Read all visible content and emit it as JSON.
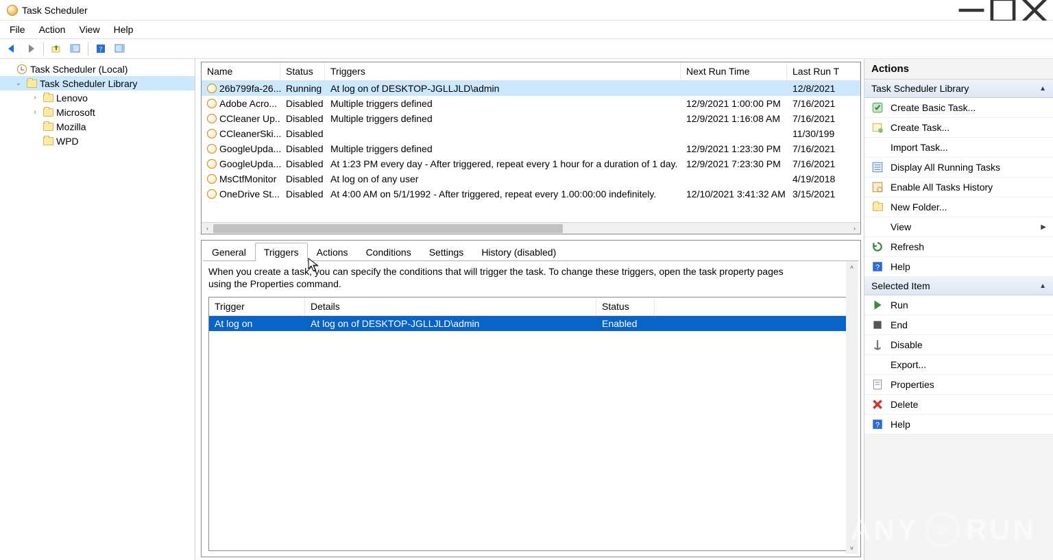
{
  "window": {
    "title": "Task Scheduler"
  },
  "menu": {
    "file": "File",
    "action": "Action",
    "view": "View",
    "help": "Help"
  },
  "tree": {
    "root": "Task Scheduler (Local)",
    "library": "Task Scheduler Library",
    "children": [
      {
        "name": "Lenovo"
      },
      {
        "name": "Microsoft"
      },
      {
        "name": "Mozilla"
      },
      {
        "name": "WPD"
      }
    ]
  },
  "task_table": {
    "columns": {
      "name": "Name",
      "status": "Status",
      "triggers": "Triggers",
      "next_run": "Next Run Time",
      "last_run": "Last Run T"
    },
    "rows": [
      {
        "name": "26b799fa-26...",
        "status": "Running",
        "triggers": "At log on of DESKTOP-JGLLJLD\\admin",
        "next_run": "",
        "last_run": "12/8/2021"
      },
      {
        "name": "Adobe Acro...",
        "status": "Disabled",
        "triggers": "Multiple triggers defined",
        "next_run": "12/9/2021 1:00:00 PM",
        "last_run": "7/16/2021"
      },
      {
        "name": "CCleaner Up...",
        "status": "Disabled",
        "triggers": "Multiple triggers defined",
        "next_run": "12/9/2021 1:16:08 AM",
        "last_run": "7/16/2021"
      },
      {
        "name": "CCleanerSki...",
        "status": "Disabled",
        "triggers": "",
        "next_run": "",
        "last_run": "11/30/199"
      },
      {
        "name": "GoogleUpda...",
        "status": "Disabled",
        "triggers": "Multiple triggers defined",
        "next_run": "12/9/2021 1:23:30 PM",
        "last_run": "7/16/2021"
      },
      {
        "name": "GoogleUpda...",
        "status": "Disabled",
        "triggers": "At 1:23 PM every day - After triggered, repeat every 1 hour for a duration of 1 day.",
        "next_run": "12/9/2021 7:23:30 PM",
        "last_run": "7/16/2021"
      },
      {
        "name": "MsCtfMonitor",
        "status": "Disabled",
        "triggers": "At log on of any user",
        "next_run": "",
        "last_run": "4/19/2018"
      },
      {
        "name": "OneDrive St...",
        "status": "Disabled",
        "triggers": "At 4:00 AM on 5/1/1992 - After triggered, repeat every 1.00:00:00 indefinitely.",
        "next_run": "12/10/2021 3:41:32 AM",
        "last_run": "3/15/2021"
      }
    ]
  },
  "tabs": {
    "general": "General",
    "triggers": "Triggers",
    "actions": "Actions",
    "conditions": "Conditions",
    "settings": "Settings",
    "history": "History (disabled)"
  },
  "triggers_tab": {
    "description": "When you create a task, you can specify the conditions that will trigger the task.  To change these triggers, open the task property pages using the Properties command.",
    "columns": {
      "trigger": "Trigger",
      "details": "Details",
      "status": "Status"
    },
    "rows": [
      {
        "trigger": "At log on",
        "details": "At log on of DESKTOP-JGLLJLD\\admin",
        "status": "Enabled"
      }
    ]
  },
  "actions_pane": {
    "title": "Actions",
    "group1": "Task Scheduler Library",
    "group1_items": {
      "create_basic": "Create Basic Task...",
      "create_task": "Create Task...",
      "import_task": "Import Task...",
      "display_running": "Display All Running Tasks",
      "enable_history": "Enable All Tasks History",
      "new_folder": "New Folder...",
      "view": "View",
      "refresh": "Refresh",
      "help": "Help"
    },
    "group2": "Selected Item",
    "group2_items": {
      "run": "Run",
      "end": "End",
      "disable": "Disable",
      "export": "Export...",
      "properties": "Properties",
      "delete": "Delete",
      "help": "Help"
    }
  },
  "watermark": "ANY▷RUN"
}
